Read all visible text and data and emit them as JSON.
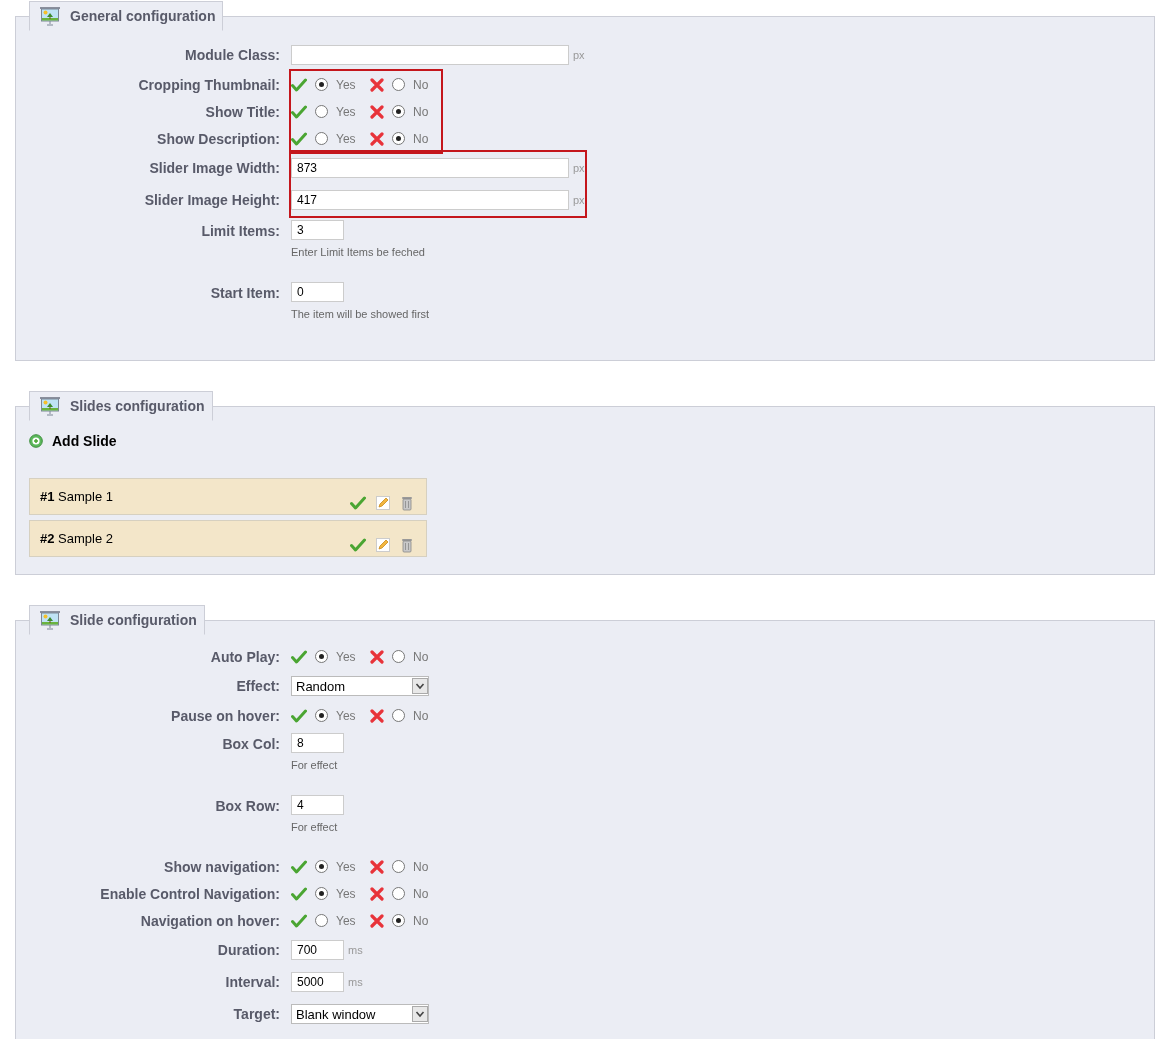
{
  "sections": [
    {
      "kind": "form",
      "title": "General configuration",
      "groups": [
        {
          "highlighted": false,
          "rows": [
            {
              "kind": "input",
              "label": "Module Class:",
              "unit": "px"
            }
          ]
        },
        {
          "highlighted": true,
          "rows": [
            {
              "kind": "radio",
              "label": "Cropping Thumbnail:",
              "options": [
                {
                  "label": "Yes",
                  "selected": true
                },
                {
                  "label": "No",
                  "selected": false
                }
              ]
            },
            {
              "kind": "radio",
              "label": "Show Title:",
              "options": [
                {
                  "label": "Yes",
                  "selected": false
                },
                {
                  "label": "No",
                  "selected": true
                }
              ]
            },
            {
              "kind": "radio",
              "label": "Show Description:",
              "options": [
                {
                  "label": "Yes",
                  "selected": false
                },
                {
                  "label": "No",
                  "selected": true
                }
              ]
            }
          ]
        },
        {
          "highlighted": true,
          "rows": [
            {
              "kind": "input",
              "label": "Slider Image Width:",
              "value": "873",
              "unit": "px"
            },
            {
              "kind": "input",
              "label": "Slider Image Height:",
              "value": "417",
              "unit": "px"
            }
          ]
        },
        {
          "highlighted": false,
          "rows": [
            {
              "kind": "input",
              "label": "Limit Items:",
              "value": "3",
              "hint": "Enter Limit Items be feched"
            }
          ]
        },
        {
          "highlighted": false,
          "rows": [
            {
              "kind": "input",
              "label": "Start Item:",
              "value": "0",
              "hint": "The item will be showed first"
            }
          ]
        }
      ]
    },
    {
      "kind": "slides",
      "title": "Slides configuration",
      "add_label": "Add Slide",
      "slides": [
        {
          "number": "#1",
          "name": "Sample 1",
          "enabled": true
        },
        {
          "number": "#2",
          "name": "Sample 2",
          "enabled": true
        }
      ]
    },
    {
      "kind": "form",
      "title": "Slide configuration",
      "groups": [
        {
          "highlighted": false,
          "rows": [
            {
              "kind": "radio",
              "label": "Auto Play:",
              "options": [
                {
                  "label": "Yes",
                  "selected": true
                },
                {
                  "label": "No",
                  "selected": false
                }
              ]
            }
          ]
        },
        {
          "highlighted": false,
          "rows": [
            {
              "kind": "select",
              "label": "Effect:",
              "value": "Random"
            }
          ]
        },
        {
          "highlighted": false,
          "rows": [
            {
              "kind": "radio",
              "label": "Pause on hover:",
              "options": [
                {
                  "label": "Yes",
                  "selected": true
                },
                {
                  "label": "No",
                  "selected": false
                }
              ]
            }
          ]
        },
        {
          "highlighted": false,
          "rows": [
            {
              "kind": "input",
              "label": "Box Col:",
              "value": "8",
              "hint": "For effect"
            }
          ]
        },
        {
          "highlighted": false,
          "rows": [
            {
              "kind": "input",
              "label": "Box Row:",
              "value": "4",
              "hint": "For effect"
            }
          ]
        },
        {
          "highlighted": false,
          "rows": [
            {
              "kind": "radio",
              "label": "Show navigation:",
              "options": [
                {
                  "label": "Yes",
                  "selected": true
                },
                {
                  "label": "No",
                  "selected": false
                }
              ]
            }
          ]
        },
        {
          "highlighted": false,
          "rows": [
            {
              "kind": "radio",
              "label": "Enable Control Navigation:",
              "options": [
                {
                  "label": "Yes",
                  "selected": true
                },
                {
                  "label": "No",
                  "selected": false
                }
              ]
            }
          ]
        },
        {
          "highlighted": false,
          "rows": [
            {
              "kind": "radio",
              "label": "Navigation on hover:",
              "options": [
                {
                  "label": "Yes",
                  "selected": false
                },
                {
                  "label": "No",
                  "selected": true
                }
              ]
            }
          ]
        },
        {
          "highlighted": false,
          "rows": [
            {
              "kind": "input",
              "label": "Duration:",
              "value": "700",
              "unit": "ms"
            }
          ]
        },
        {
          "highlighted": false,
          "rows": [
            {
              "kind": "input",
              "label": "Interval:",
              "value": "5000",
              "unit": "ms"
            }
          ]
        },
        {
          "highlighted": false,
          "rows": [
            {
              "kind": "select",
              "label": "Target:",
              "value": "Blank window"
            }
          ]
        }
      ]
    }
  ]
}
